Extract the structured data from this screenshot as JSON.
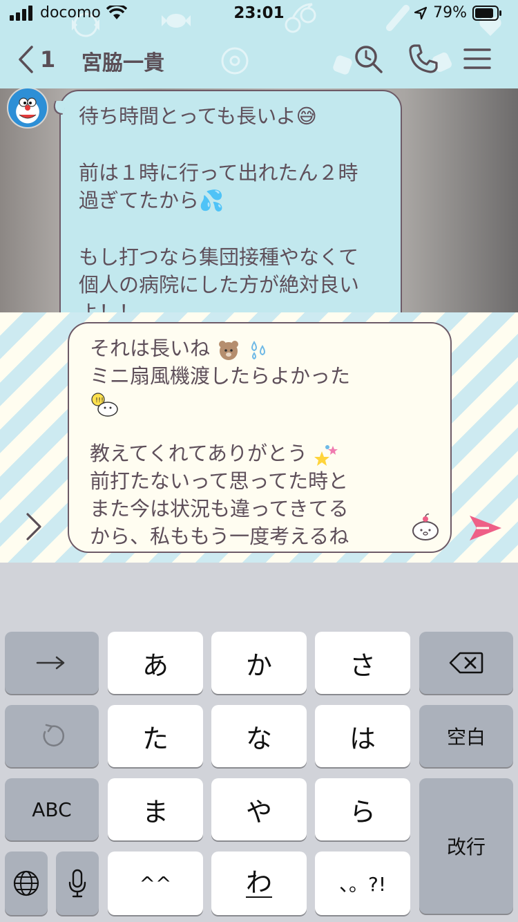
{
  "status_bar": {
    "carrier": "docomo",
    "time": "23:01",
    "battery": "79%",
    "icons": [
      "signal-icon",
      "wifi-icon",
      "location-arrow-icon",
      "battery-icon"
    ]
  },
  "header": {
    "back_count": "1",
    "title": "宮脇一貴",
    "icons": [
      "chevron-left-icon",
      "search-icon",
      "phone-icon",
      "menu-icon"
    ],
    "bg_color": "#c2e8ee"
  },
  "received_message": {
    "lines": [
      "待ち時間とっても長いよ😅",
      "",
      "前は１時に行って出れたん２時",
      "過ぎてたから💦",
      "",
      "もし打つなら集団接種やなくて",
      "個人の病院にした方が絶対良い",
      "よ！！"
    ]
  },
  "compose": {
    "lines": [
      "それは長いね",
      "ミニ扇風機渡したらよかった",
      "",
      "教えてくれてありがとう",
      "前打たないって思ってた時と",
      "また今は状況も違ってきてる",
      "から、私ももう一度考えるね"
    ],
    "accent_color": "#ee5f87"
  },
  "keyboard": {
    "rows": [
      [
        "→",
        "あ",
        "か",
        "さ",
        "⌫"
      ],
      [
        "↺",
        "た",
        "な",
        "は",
        "空白"
      ],
      [
        "ABC",
        "ま",
        "や",
        "ら",
        "改行"
      ],
      [
        "🌐",
        "🎤",
        "^^",
        "わ",
        "、。?!"
      ]
    ],
    "keys": {
      "arrow": "→",
      "a": "あ",
      "ka": "か",
      "sa": "さ",
      "undo": "↺",
      "ta": "た",
      "na": "な",
      "ha": "は",
      "space": "空白",
      "abc": "ABC",
      "ma": "ま",
      "ya": "や",
      "ra": "ら",
      "enter": "改行",
      "kaomoji": "^^",
      "wa": "わ",
      "punct": "、。?!"
    }
  }
}
